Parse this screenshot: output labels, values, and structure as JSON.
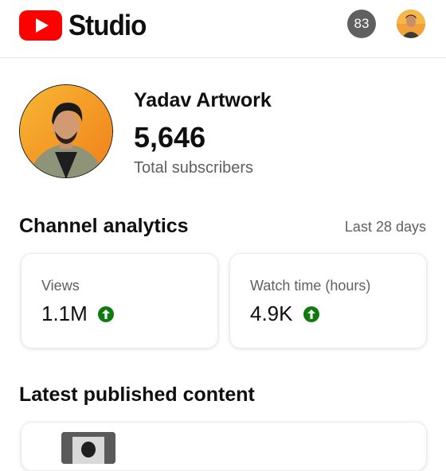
{
  "header": {
    "app_title": "Studio",
    "notification_count": "83",
    "brand_color": "#ff0000"
  },
  "channel": {
    "name": "Yadav Artwork",
    "subscriber_count": "5,646",
    "subscriber_label": "Total subscribers"
  },
  "analytics": {
    "title": "Channel analytics",
    "period": "Last 28 days",
    "cards": [
      {
        "label": "Views",
        "value": "1.1M",
        "trend_icon": "arrow-up-circle-icon",
        "trend_color": "#0f7b0f"
      },
      {
        "label": "Watch time (hours)",
        "value": "4.9K",
        "trend_icon": "arrow-up-circle-icon",
        "trend_color": "#0f7b0f"
      }
    ]
  },
  "latest": {
    "title": "Latest published content"
  }
}
